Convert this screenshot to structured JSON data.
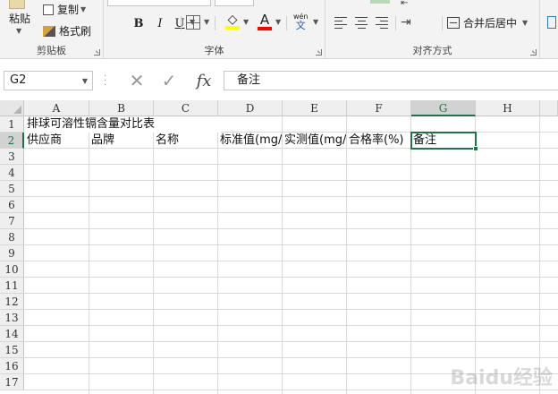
{
  "ribbon": {
    "clipboard": {
      "group_label": "剪贴板",
      "paste_label": "粘贴",
      "copy_label": "复制",
      "format_painter_label": "格式刷"
    },
    "font": {
      "group_label": "字体",
      "bold": "B",
      "italic": "I",
      "underline": "U",
      "font_color_letter": "A",
      "phonetic_top": "wén",
      "phonetic_bottom": "文"
    },
    "alignment": {
      "group_label": "对齐方式",
      "merge_center_label": "合并后居中"
    }
  },
  "formula_bar": {
    "name_box": "G2",
    "formula": "备注",
    "fx": "fx"
  },
  "sheet": {
    "columns": [
      "A",
      "B",
      "C",
      "D",
      "E",
      "F",
      "G",
      "H"
    ],
    "rows": [
      "1",
      "2",
      "3",
      "4",
      "5",
      "6",
      "7",
      "8",
      "9",
      "10",
      "11",
      "12",
      "13",
      "14",
      "15",
      "16",
      "17"
    ],
    "cells": {
      "A1": "排球可溶性镉含量对比表",
      "A2": "供应商",
      "B2": "品牌",
      "C2": "名称",
      "D2": "标准值(mg/kg)",
      "E2": "实测值(mg/kg)",
      "F2": "合格率(%)",
      "G2": "备注"
    },
    "selected_cell": "G2",
    "accent_color": "#217346"
  },
  "watermark": "Baidu经验"
}
